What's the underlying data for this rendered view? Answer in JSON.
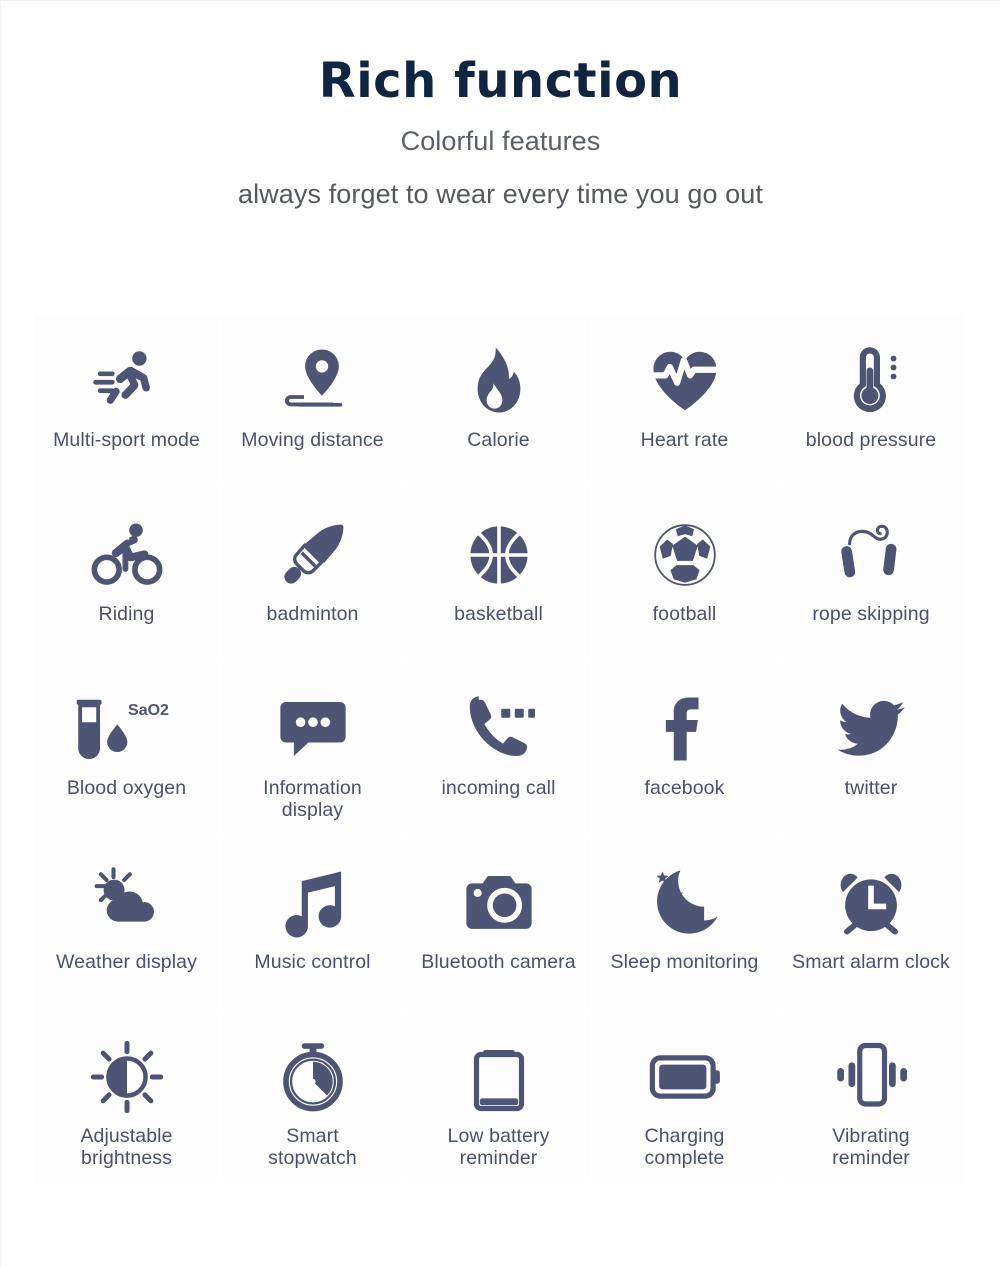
{
  "header": {
    "title": "Rich function",
    "subtitle": "Colorful features",
    "subtitle2": "always forget to wear every time you go out"
  },
  "colors": {
    "title": "#10253f",
    "subtitle": "#5b6066",
    "icon": "#4d5474",
    "label": "#4a5071",
    "cell_background": "#fdfdfe",
    "page_background": "#ffffff"
  },
  "features": [
    {
      "icon": "running-man-icon",
      "label": "Multi-sport mode"
    },
    {
      "icon": "map-pin-distance-icon",
      "label": "Moving distance"
    },
    {
      "icon": "flame-icon",
      "label": "Calorie"
    },
    {
      "icon": "heart-pulse-icon",
      "label": "Heart rate"
    },
    {
      "icon": "thermometer-icon",
      "label": "blood pressure"
    },
    {
      "icon": "cyclist-icon",
      "label": "Riding"
    },
    {
      "icon": "shuttlecock-icon",
      "label": "badminton"
    },
    {
      "icon": "basketball-icon",
      "label": "basketball"
    },
    {
      "icon": "soccer-ball-icon",
      "label": "football"
    },
    {
      "icon": "jump-rope-icon",
      "label": "rope skipping"
    },
    {
      "icon": "blood-test-tube-icon",
      "label": "Blood oxygen",
      "icon_text": "SaO2"
    },
    {
      "icon": "chat-bubble-icon",
      "label": "Information\ndisplay"
    },
    {
      "icon": "phone-call-icon",
      "label": "incoming call"
    },
    {
      "icon": "facebook-icon",
      "label": "facebook"
    },
    {
      "icon": "twitter-bird-icon",
      "label": "twitter"
    },
    {
      "icon": "sun-cloud-icon",
      "label": "Weather display"
    },
    {
      "icon": "music-note-icon",
      "label": "Music control"
    },
    {
      "icon": "camera-icon",
      "label": "Bluetooth camera"
    },
    {
      "icon": "moon-star-icon",
      "label": "Sleep monitoring"
    },
    {
      "icon": "alarm-clock-icon",
      "label": "Smart alarm clock"
    },
    {
      "icon": "brightness-sun-icon",
      "label": "Adjustable\nbrightness"
    },
    {
      "icon": "stopwatch-icon",
      "label": "Smart\nstopwatch"
    },
    {
      "icon": "battery-empty-icon",
      "label": "Low battery\nreminder"
    },
    {
      "icon": "battery-full-icon",
      "label": "Charging\ncomplete"
    },
    {
      "icon": "vibrate-phone-icon",
      "label": "Vibrating\nreminder"
    }
  ]
}
